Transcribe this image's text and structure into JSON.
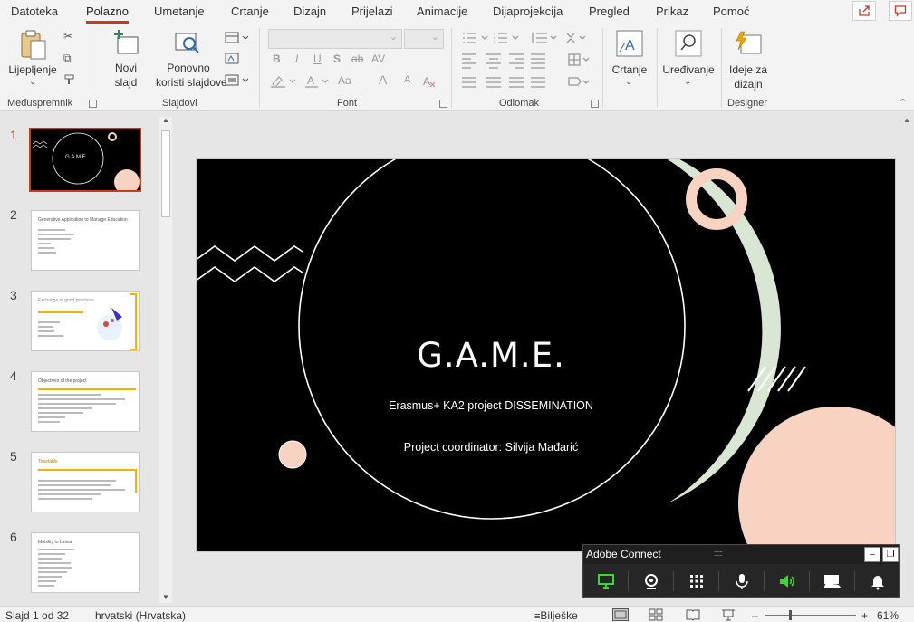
{
  "tabs": [
    "Datoteka",
    "Polazno",
    "Umetanje",
    "Crtanje",
    "Dizajn",
    "Prijelazi",
    "Animacije",
    "Dijaprojekcija",
    "Pregled",
    "Prikaz",
    "Pomoć"
  ],
  "active_tab": "Polazno",
  "ribbon": {
    "clipboard": {
      "paste_label": "Lijepljenje",
      "group": "Međuspremnik"
    },
    "slides": {
      "new_slide": "Novi",
      "new_slide2": "slajd",
      "reuse": "Ponovno",
      "reuse2": "koristi slajdove",
      "group": "Slajdovi"
    },
    "font": {
      "group": "Font",
      "bold": "B",
      "italic": "I",
      "underline": "U",
      "shadow": "S",
      "strike": "ab",
      "spacing": "AV",
      "case": "Aa",
      "grow": "A",
      "shrink": "A"
    },
    "paragraph": {
      "group": "Odlomak"
    },
    "drawing": {
      "label": "Crtanje"
    },
    "editing": {
      "label": "Uređivanje"
    },
    "designer": {
      "label1": "Ideje za",
      "label2": "dizajn",
      "group": "Designer"
    }
  },
  "thumbnails": [
    {
      "num": "1",
      "title": "G.A.M.E."
    },
    {
      "num": "2",
      "title": "Generative Application to Manage Education"
    },
    {
      "num": "3",
      "title": "Exchange of good practices"
    },
    {
      "num": "4",
      "title": "Objectives of the project"
    },
    {
      "num": "5",
      "title": "Timetable"
    },
    {
      "num": "6",
      "title": "Mobility to Latvia"
    }
  ],
  "slide": {
    "title": "G.A.M.E.",
    "subtitle1": "Erasmus+ KA2 project DISSEMINATION",
    "subtitle2": "Project coordinator: Silvija Mađarić"
  },
  "adobe_connect": {
    "title": "Adobe Connect",
    "minimize": "–",
    "restore": "❐"
  },
  "status": {
    "slide_counter": "Slajd 1 od 32",
    "language": "hrvatski (Hrvatska)",
    "notes": "Bilješke",
    "zoom_minus": "–",
    "zoom_plus": "+",
    "zoom": "61%"
  },
  "colors": {
    "accent": "#c43e1c",
    "peach": "#f9d3c1",
    "sage": "#d9e6d3"
  }
}
